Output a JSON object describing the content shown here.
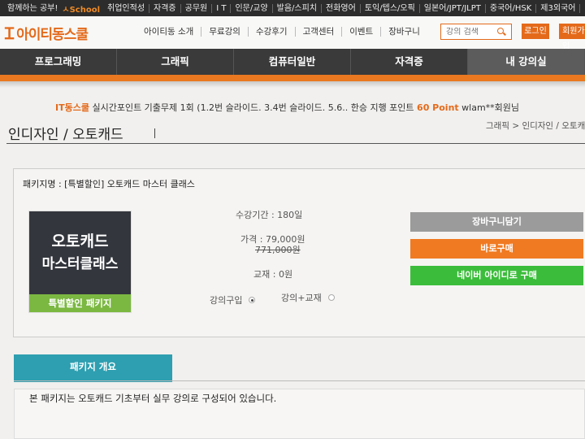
{
  "topbar": {
    "items": [
      "함께하는 공부!",
      "취업인적성",
      "자격증",
      "공무원",
      "I T",
      "인문/교양",
      "발음/스피치",
      "전화영어",
      "토익/텝스/오픽",
      "일본어/JPT/JLPT",
      "중국어/HSK",
      "제3외국어"
    ],
    "school_label": "ㅅSchool"
  },
  "header": {
    "logo_text": "아이티동스쿨",
    "nav": [
      "아이티동 소개",
      "무료강의",
      "수강후기",
      "고객센터",
      "이벤트",
      "장바구니"
    ],
    "search_placeholder": "강의 검색",
    "login_label": "로그인",
    "join_label": "회원가입"
  },
  "mainnav": {
    "items": [
      "프로그래밍",
      "그래픽",
      "컴퓨터일반",
      "자격증",
      "내 강의실"
    ]
  },
  "ticker": {
    "prefix": "IT동스쿨",
    "middle": " 실시간포인트  기출무제 1회 (1.2번 슬라이드. 3.4번 슬라이드. 5.6.. 한승 지행 포인트 ",
    "points": "60 Point",
    "user": " wlam**회원님"
  },
  "page": {
    "title": "인디자인 / 오토캐드",
    "breadcrumb": "그래픽 > 인디자인 / 오토캐드"
  },
  "product": {
    "package_name": "패키지명 : [특별할인] 오토캐드 마스터 클래스",
    "thumb_line1": "오토캐드",
    "thumb_line2": "마스터클래스",
    "thumb_band": "특별할인 패키지",
    "period": "수강기간 : 180일",
    "price": "가격 : 79,000원",
    "original_price": "771,000원",
    "textbook": "교재 : 0원",
    "option_lecture": "강의구입",
    "option_lecture_textbook": "강의+교재",
    "cart_label": "장바구니담기",
    "buy_label": "바로구매",
    "naver_label": "네이버 아이디로 구매"
  },
  "overview": {
    "tab_label": "패키지 개요",
    "text": "본 패키지는 오토캐드 기초부터 실무 강의로 구성되어 있습니다."
  },
  "colors": {
    "accent": "#e97820",
    "nav_bg": "#3a3a3a",
    "naver_green": "#3bbd3b",
    "tab_blue": "#2e9fb0"
  }
}
